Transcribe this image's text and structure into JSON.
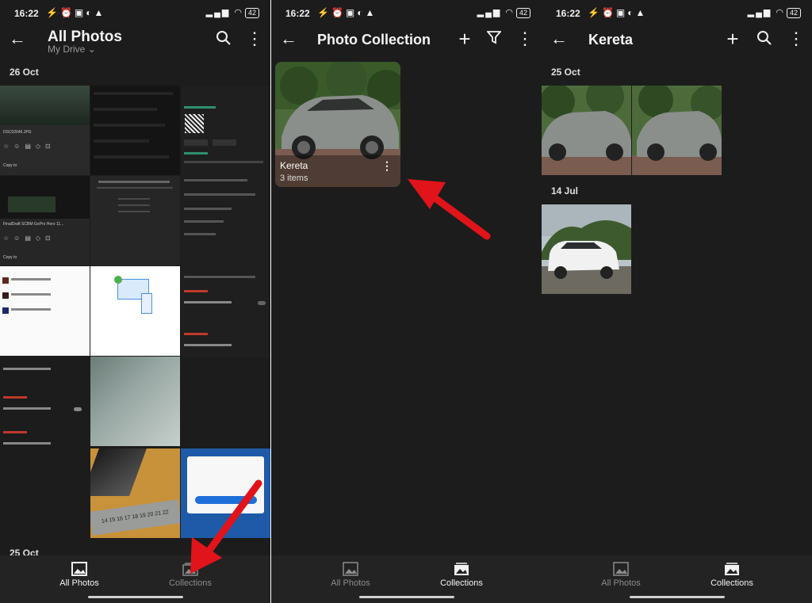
{
  "status": {
    "time": "16:22",
    "battery": "42"
  },
  "screen1": {
    "title": "All Photos",
    "subtitle": "My Drive",
    "date_top": "26 Oct",
    "date_bottom": "25 Oct",
    "nav": {
      "all_photos": "All Photos",
      "collections": "Collections"
    },
    "active_tab": "all_photos"
  },
  "screen2": {
    "title": "Photo Collection",
    "collection": {
      "name": "Kereta",
      "count": "3 items"
    },
    "nav": {
      "all_photos": "All Photos",
      "collections": "Collections"
    },
    "active_tab": "collections"
  },
  "screen3": {
    "title": "Kereta",
    "date_1": "25 Oct",
    "date_2": "14 Jul",
    "nav": {
      "all_photos": "All Photos",
      "collections": "Collections"
    },
    "active_tab": "collections"
  },
  "colors": {
    "background": "#1c1c1c",
    "nav_bg": "#232323",
    "annotation_arrow": "#e0141a"
  }
}
